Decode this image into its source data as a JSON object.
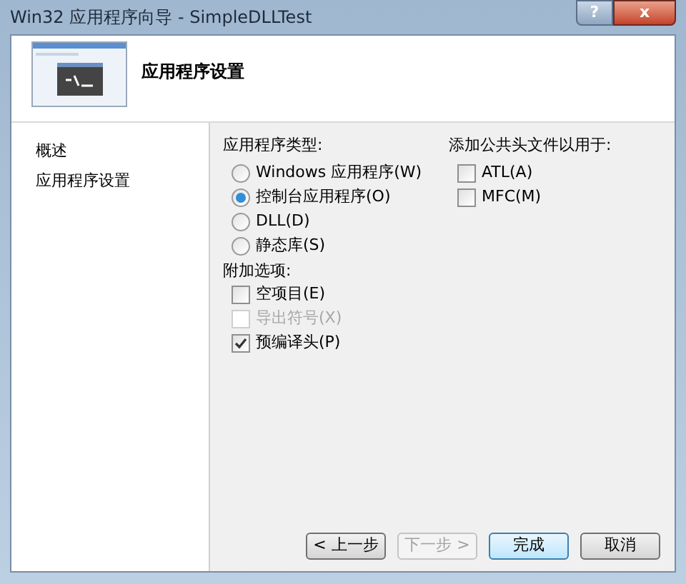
{
  "window": {
    "title": "Win32 应用程序向导 - SimpleDLLTest",
    "help_button": "?",
    "close_button": "x"
  },
  "header": {
    "title": "应用程序设置"
  },
  "sidebar": {
    "items": [
      {
        "label": "概述"
      },
      {
        "label": "应用程序设置"
      }
    ]
  },
  "application_type": {
    "label": "应用程序类型:",
    "options": [
      {
        "label": "Windows 应用程序(W)",
        "selected": false
      },
      {
        "label": "控制台应用程序(O)",
        "selected": true
      },
      {
        "label": "DLL(D)",
        "selected": false
      },
      {
        "label": "静态库(S)",
        "selected": false
      }
    ]
  },
  "additional_options": {
    "label": "附加选项:",
    "options": [
      {
        "label": "空项目(E)",
        "checked": false,
        "disabled": false
      },
      {
        "label": "导出符号(X)",
        "checked": false,
        "disabled": true
      },
      {
        "label": "预编译头(P)",
        "checked": true,
        "disabled": false
      }
    ]
  },
  "common_headers": {
    "label": "添加公共头文件以用于:",
    "options": [
      {
        "label": "ATL(A)",
        "checked": false,
        "disabled": false
      },
      {
        "label": "MFC(M)",
        "checked": false,
        "disabled": false
      }
    ]
  },
  "buttons": [
    {
      "label": "< 上一步",
      "disabled": false,
      "default": false
    },
    {
      "label": "下一步 >",
      "disabled": true,
      "default": false
    },
    {
      "label": "完成",
      "disabled": false,
      "default": true
    },
    {
      "label": "取消",
      "disabled": false,
      "default": false
    }
  ]
}
